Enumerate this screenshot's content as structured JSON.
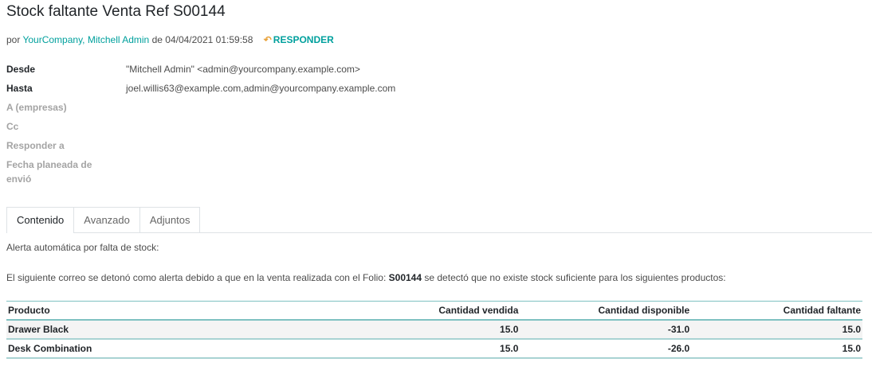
{
  "title": "Stock faltante Venta Ref S00144",
  "byline": {
    "prefix": "por",
    "author": "YourCompany, Mitchell Admin",
    "date_prefix": "de",
    "date": "04/04/2021 01:59:58",
    "reply_label": "RESPONDER"
  },
  "fields": {
    "desde_label": "Desde",
    "desde_value": "\"Mitchell Admin\" <admin@yourcompany.example.com>",
    "hasta_label": "Hasta",
    "hasta_value": "joel.willis63@example.com,admin@yourcompany.example.com",
    "empresas_label": "A (empresas)",
    "cc_label": "Cc",
    "responder_label": "Responder a",
    "fecha_label": "Fecha planeada de envió"
  },
  "tabs": [
    "Contenido",
    "Avanzado",
    "Adjuntos"
  ],
  "content": {
    "line1": "Alerta automática por falta de stock:",
    "line2_before": "El siguiente correo se detonó como alerta debido a que en la venta realizada con el Folio:",
    "line2_folio": "S00144",
    "line2_after": "se detectó que no existe stock suficiente para los siguientes productos:"
  },
  "table": {
    "headers": [
      "Producto",
      "Cantidad vendida",
      "Cantidad disponible",
      "Cantidad faltante"
    ],
    "rows": [
      [
        "Drawer Black",
        "15.0",
        "-31.0",
        "15.0"
      ],
      [
        "Desk Combination",
        "15.0",
        "-26.0",
        "15.0"
      ]
    ]
  },
  "colors": {
    "link": "#00a09d",
    "reply_arrow": "#e8a23a",
    "table_rule": "#7fc1c1"
  }
}
